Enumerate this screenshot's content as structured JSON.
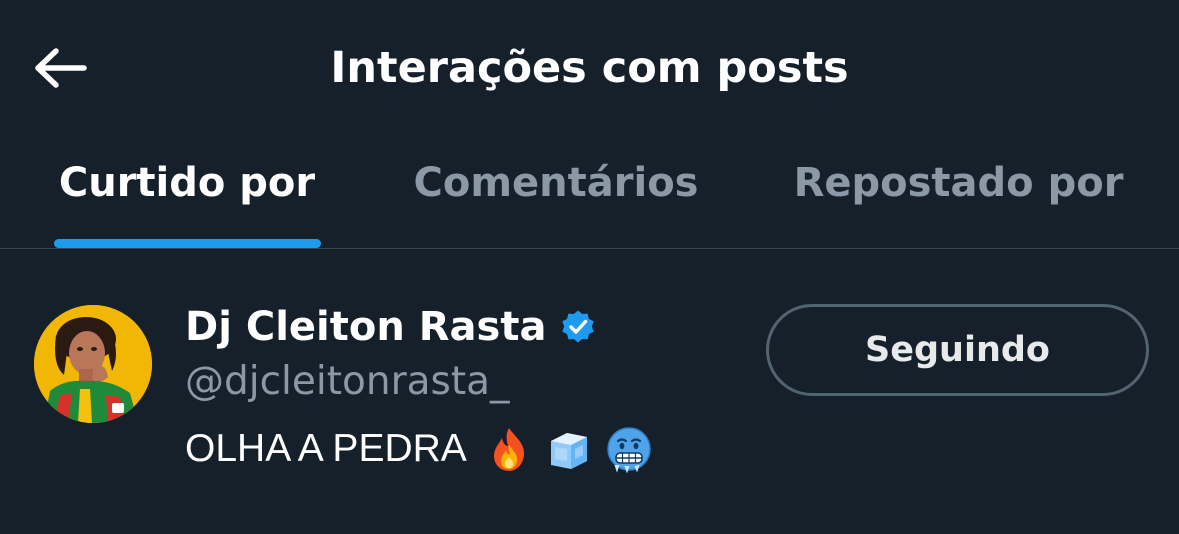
{
  "header": {
    "title": "Interações com posts",
    "back_icon": "arrow-left-icon"
  },
  "tabs": [
    {
      "label": "Curtido por",
      "active": true
    },
    {
      "label": "Comentários",
      "active": false
    },
    {
      "label": "Repostado por",
      "active": false
    }
  ],
  "colors": {
    "background": "#15202b",
    "accent": "#1d9bf0",
    "secondary_text": "#8b98a5",
    "divider": "#38444d",
    "button_border": "#536471"
  },
  "users": [
    {
      "display_name": "Dj Cleiton Rasta",
      "verified": true,
      "verified_icon": "verified-badge-icon",
      "handle": "@djcleitonrasta_",
      "bio": "OLHA A PEDRA",
      "bio_emojis": [
        "fire-emoji",
        "ice-cube-emoji",
        "cold-face-emoji"
      ],
      "follow_label": "Seguindo"
    }
  ]
}
